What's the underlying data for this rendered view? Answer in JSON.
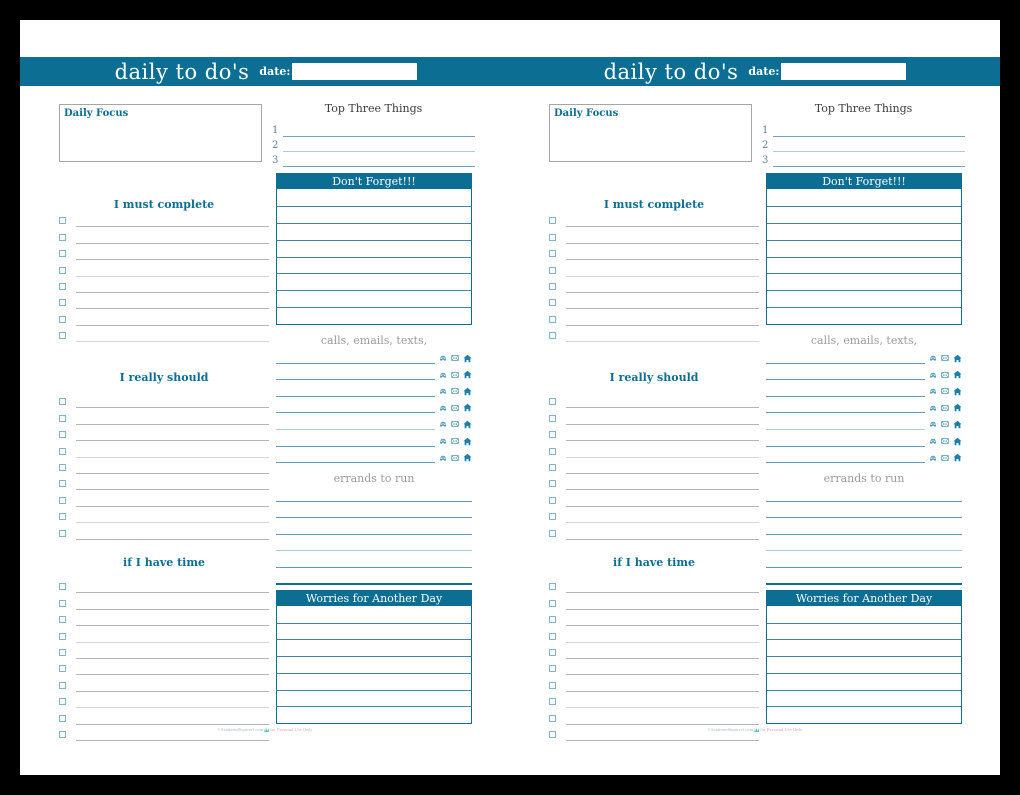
{
  "document": {
    "title": "daily to do's",
    "page_count": 2
  },
  "header": {
    "title": "daily to do's",
    "date_label": "date:",
    "date_value": "",
    "date_placeholder": "",
    "background_color": "#0c6e93",
    "text_color": "#ffffff"
  },
  "daily_focus": {
    "label": "Daily Focus",
    "value": "",
    "border_color": "#a6a6a6",
    "label_color": "#0c6e93"
  },
  "top_three": {
    "heading": "Top Three Things",
    "items": [
      {
        "number": "1",
        "value": ""
      },
      {
        "number": "2",
        "value": ""
      },
      {
        "number": "3",
        "value": ""
      }
    ]
  },
  "must_complete": {
    "heading": "I must complete",
    "row_count": 8,
    "rows": [
      "",
      "",
      "",
      "",
      "",
      "",
      "",
      ""
    ]
  },
  "really_should": {
    "heading": "I really should",
    "row_count": 9,
    "rows": [
      "",
      "",
      "",
      "",
      "",
      "",
      "",
      "",
      ""
    ]
  },
  "if_i_have_time": {
    "heading": "if I have time",
    "row_count": 10,
    "rows": [
      "",
      "",
      "",
      "",
      "",
      "",
      "",
      "",
      "",
      ""
    ]
  },
  "dont_forget": {
    "heading": "Don't Forget!!!",
    "row_count": 8,
    "rows": [
      "",
      "",
      "",
      "",
      "",
      "",
      "",
      ""
    ],
    "header_color": "#0c6e93",
    "border_color": "#0c6e93"
  },
  "calls_emails_texts": {
    "heading": "calls, emails, texts,",
    "heading_color": "#9b9b9b",
    "row_count": 7,
    "rows": [
      "",
      "",
      "",
      "",
      "",
      "",
      ""
    ],
    "icons": [
      "phone-icon",
      "envelope-icon",
      "house-icon"
    ],
    "icon_color": "#1d7fa3"
  },
  "errands": {
    "heading": "errands to run",
    "heading_color": "#9b9b9b",
    "row_count": 6,
    "rows": [
      "",
      "",
      "",
      "",
      "",
      ""
    ]
  },
  "worries": {
    "heading": "Worries for Another Day",
    "row_count": 7,
    "rows": [
      "",
      "",
      "",
      "",
      "",
      "",
      ""
    ],
    "header_color": "#0c6e93",
    "border_color": "#0c6e93"
  },
  "footer": {
    "credit": "©ScatteredSquirrel.com",
    "credit_suffix": "for Personal Use Only",
    "mark": "squirrel-logo-icon"
  },
  "theme": {
    "teal": "#0c6e93",
    "line_blue": "#5d9cbb",
    "line_blue_pale": "#a9cddd",
    "line_gray": "#b5b5b5",
    "line_gray_pale": "#d6d6d6",
    "checkbox_border": "#7fb4cf",
    "paper": "#ffffff",
    "backdrop": "#000000"
  }
}
